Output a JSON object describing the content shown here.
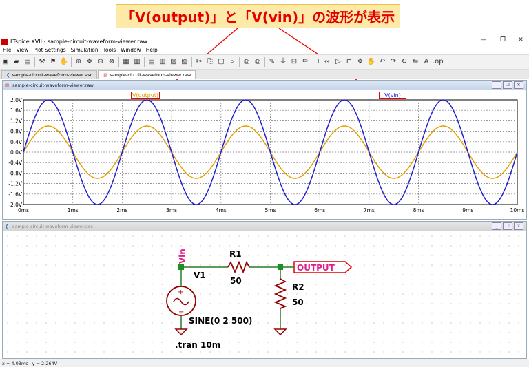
{
  "annotation": {
    "text": "「V(output)」と「V(vin)」の波形が表示"
  },
  "app": {
    "title": "LTspice XVII - sample-circuit-waveform-viewer.raw"
  },
  "menu": [
    "File",
    "View",
    "Plot Settings",
    "Simulation",
    "Tools",
    "Window",
    "Help"
  ],
  "tabs": [
    {
      "label": "sample-circuit-waveform-viewer.asc",
      "active": false
    },
    {
      "label": "sample-circuit-waveform-viewer.raw",
      "active": true
    }
  ],
  "wave_window": {
    "title": "sample-circuit-waveform-viewer.raw"
  },
  "traces": {
    "output_label": "V(output)",
    "vin_label": "V(vin)",
    "output_color": "#e0a000",
    "vin_color": "#2020d0"
  },
  "chart_data": {
    "type": "line",
    "x_ticks": [
      "0ms",
      "1ms",
      "2ms",
      "3ms",
      "4ms",
      "5ms",
      "6ms",
      "7ms",
      "8ms",
      "9ms",
      "10ms"
    ],
    "y_ticks": [
      "2.0V",
      "1.6V",
      "1.2V",
      "0.8V",
      "0.4V",
      "0.0V",
      "-0.4V",
      "-0.8V",
      "-1.2V",
      "-1.6V",
      "-2.0V"
    ],
    "xlim": [
      0,
      10
    ],
    "ylim": [
      -2.0,
      2.0
    ],
    "grid": true,
    "series": [
      {
        "name": "V(output)",
        "amplitude": 1.0,
        "frequency_hz": 500,
        "color": "#e0a000"
      },
      {
        "name": "V(vin)",
        "amplitude": 2.0,
        "frequency_hz": 500,
        "color": "#2020d0"
      }
    ]
  },
  "schematic_window": {
    "title": "sample-circuit-waveform-viewer.asc"
  },
  "schematic": {
    "vin_net": "Vin",
    "output_net": "OUTPUT",
    "r1_name": "R1",
    "r1_value": "50",
    "r2_name": "R2",
    "r2_value": "50",
    "v1_name": "V1",
    "v1_value": "SINE(0 2 500)",
    "directive": ".tran 10m"
  },
  "status": {
    "x": "x = 4.03ms",
    "y": "y = 2.264V"
  }
}
